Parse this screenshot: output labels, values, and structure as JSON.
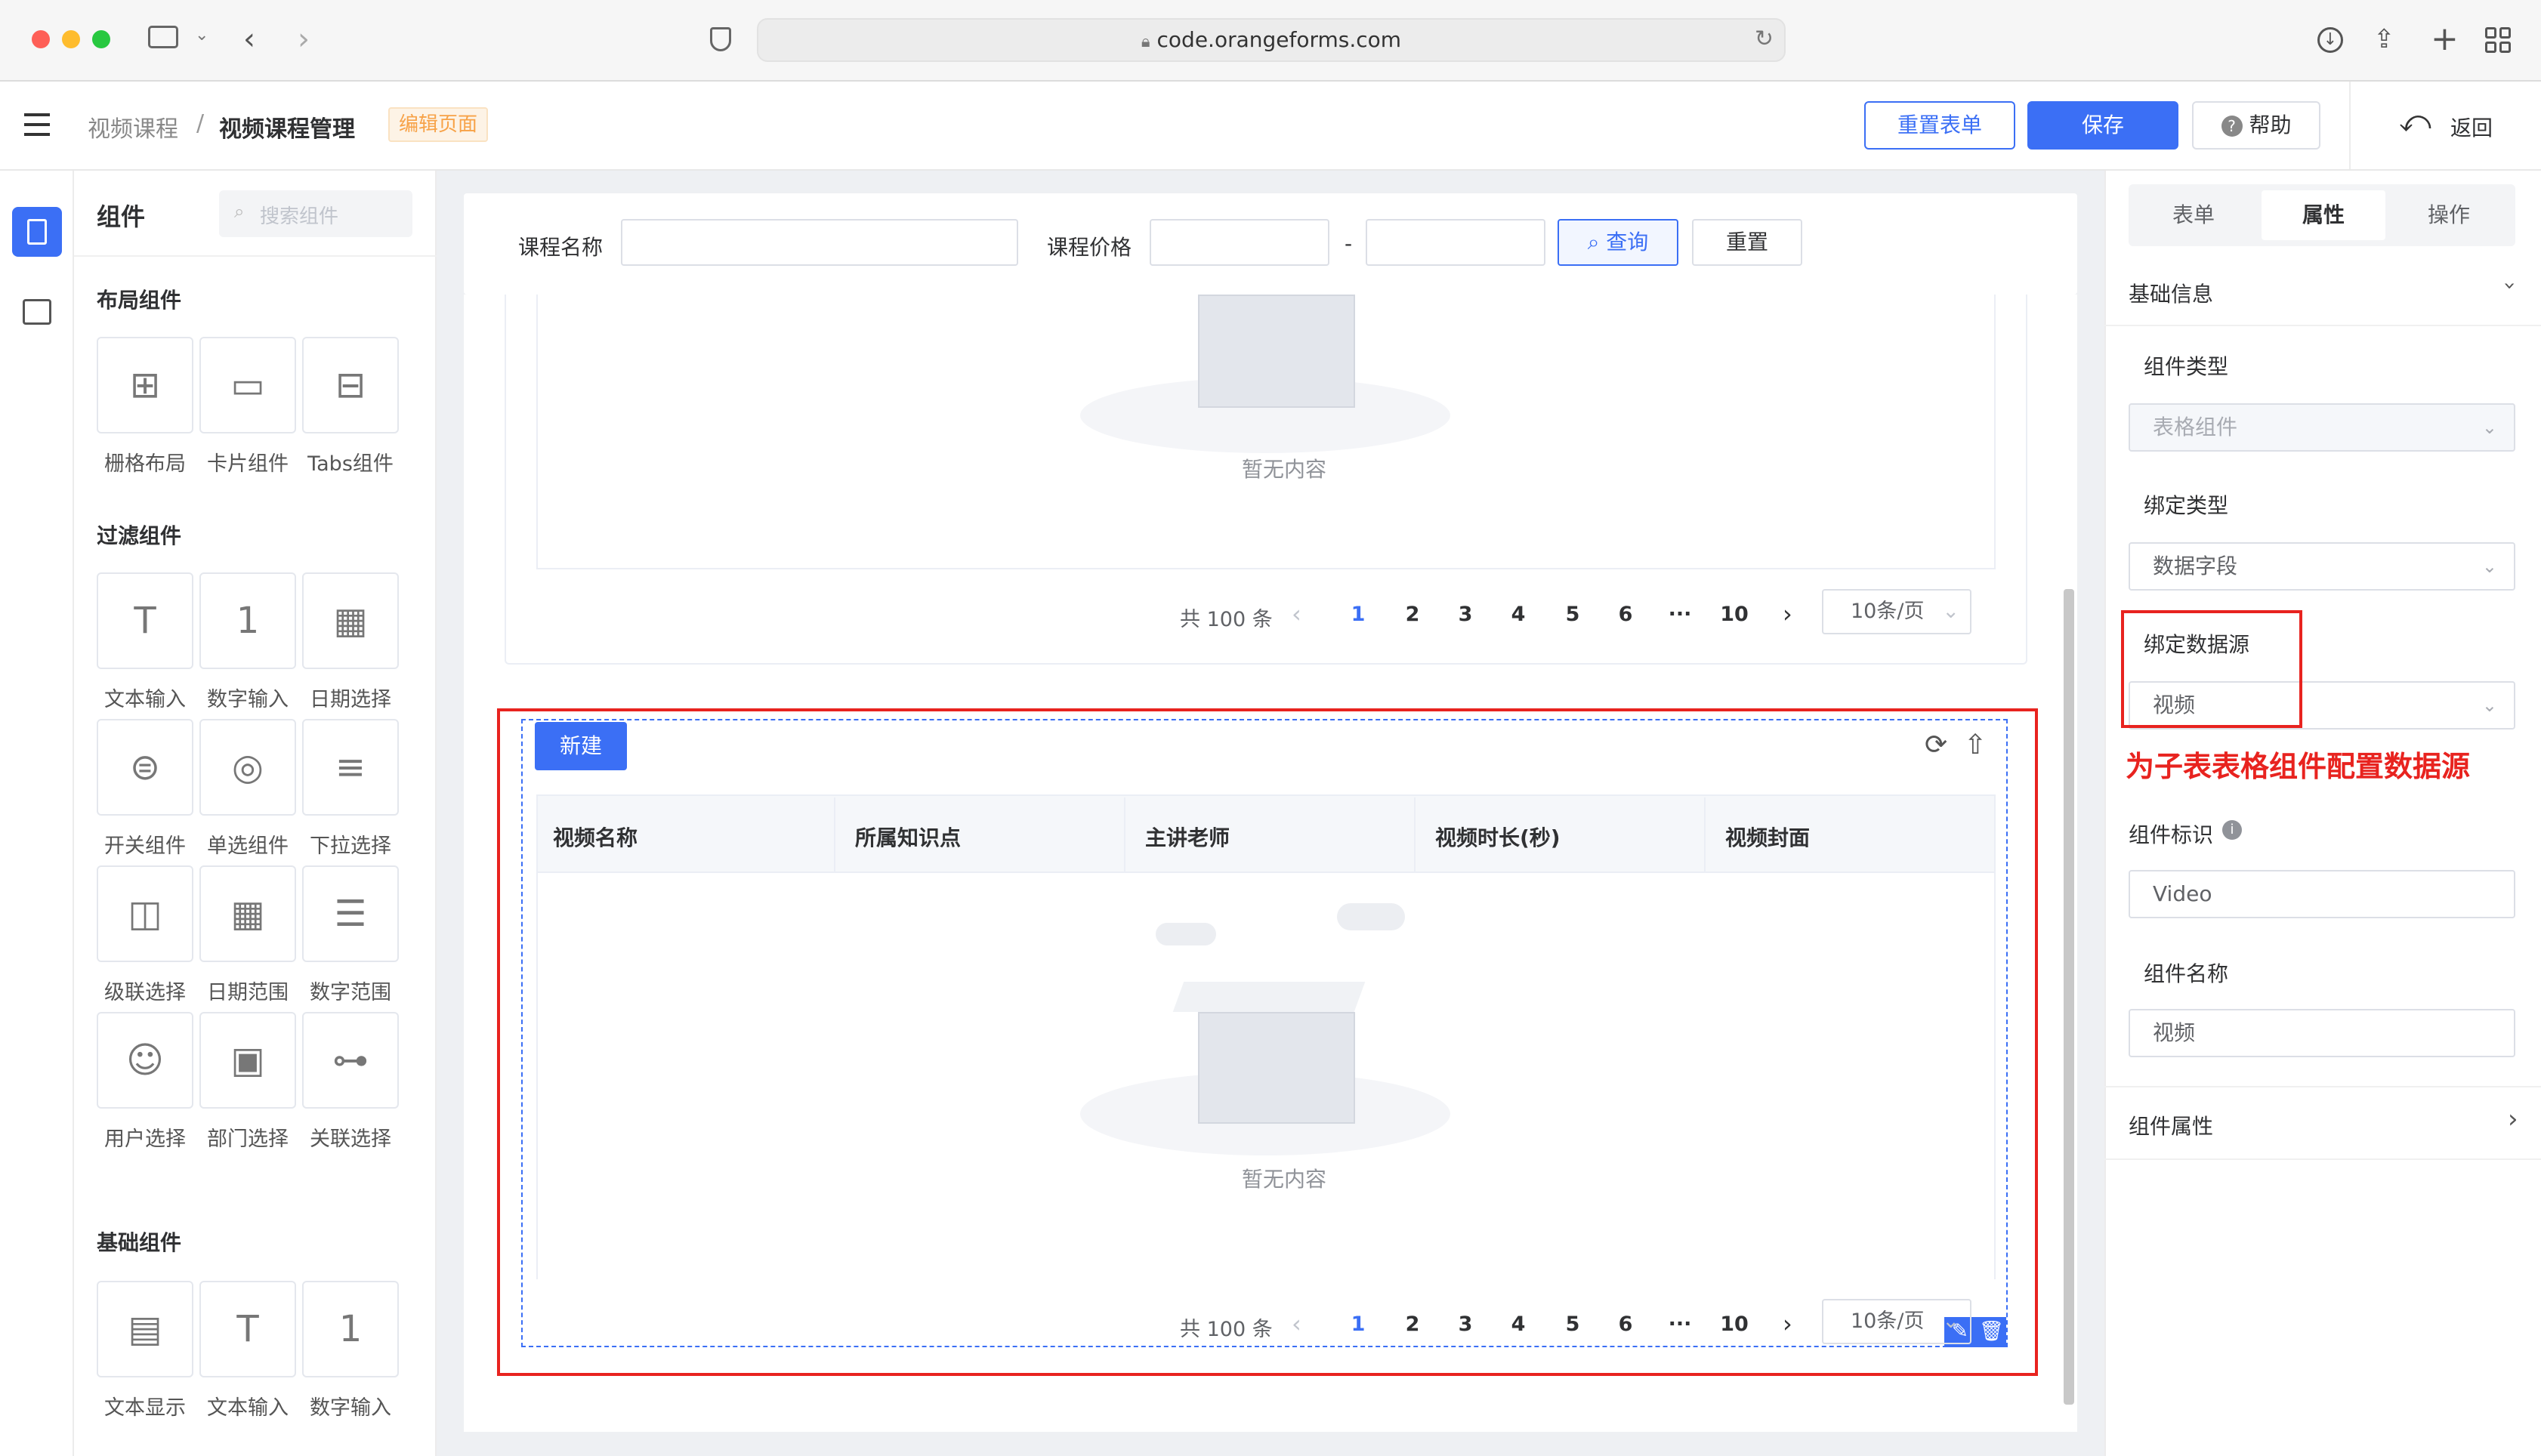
{
  "browser": {
    "url": "code.orangeforms.com"
  },
  "header": {
    "breadcrumb_parent": "视频课程",
    "breadcrumb_sep": "/",
    "breadcrumb_current": "视频课程管理",
    "mode_tag": "编辑页面",
    "reset_form": "重置表单",
    "save": "保存",
    "help": "帮助",
    "back": "返回"
  },
  "components": {
    "title": "组件",
    "search_placeholder": "搜索组件",
    "layout_title": "布局组件",
    "layout_items": [
      {
        "label": "栅格布局",
        "icon": "grid-icon"
      },
      {
        "label": "卡片组件",
        "icon": "card-icon"
      },
      {
        "label": "Tabs组件",
        "icon": "tabs-icon"
      }
    ],
    "filter_title": "过滤组件",
    "filter_items": [
      {
        "label": "文本输入",
        "icon": "text-input-icon"
      },
      {
        "label": "数字输入",
        "icon": "number-input-icon"
      },
      {
        "label": "日期选择",
        "icon": "calendar-icon"
      },
      {
        "label": "开关组件",
        "icon": "switch-icon"
      },
      {
        "label": "单选组件",
        "icon": "radio-icon"
      },
      {
        "label": "下拉选择",
        "icon": "dropdown-icon"
      },
      {
        "label": "级联选择",
        "icon": "cascader-icon"
      },
      {
        "label": "日期范围",
        "icon": "date-range-icon"
      },
      {
        "label": "数字范围",
        "icon": "number-range-icon"
      },
      {
        "label": "用户选择",
        "icon": "user-icon"
      },
      {
        "label": "部门选择",
        "icon": "department-icon"
      },
      {
        "label": "关联选择",
        "icon": "relation-icon"
      }
    ],
    "basic_title": "基础组件",
    "basic_items": [
      {
        "label": "文本显示",
        "icon": "text-display-icon"
      },
      {
        "label": "文本输入",
        "icon": "text-input-icon"
      },
      {
        "label": "数字输入",
        "icon": "number-input-icon"
      }
    ]
  },
  "filter": {
    "course_name_label": "课程名称",
    "course_price_label": "课程价格",
    "range_sep": "-",
    "query": "查询",
    "reset": "重置"
  },
  "top_table": {
    "empty": "暂无内容",
    "total": "共 100 条",
    "pages": [
      "1",
      "2",
      "3",
      "4",
      "5",
      "6",
      "···",
      "10"
    ],
    "page_size": "10条/页"
  },
  "sub_table": {
    "new_button": "新建",
    "columns": [
      "视频名称",
      "所属知识点",
      "主讲老师",
      "视频时长(秒)",
      "视频封面"
    ],
    "empty": "暂无内容",
    "total": "共 100 条",
    "pages": [
      "1",
      "2",
      "3",
      "4",
      "5",
      "6",
      "···",
      "10"
    ],
    "page_size": "10条/页"
  },
  "right": {
    "tabs": [
      "表单",
      "属性",
      "操作"
    ],
    "active_tab": "属性",
    "basic_info": "基础信息",
    "component_type_label": "组件类型",
    "component_type_value": "表格组件",
    "bind_type_label": "绑定类型",
    "bind_type_value": "数据字段",
    "datasource_label": "绑定数据源",
    "datasource_value": "视频",
    "annotation": "为子表表格组件配置数据源",
    "component_id_label": "组件标识",
    "component_id_value": "Video",
    "component_name_label": "组件名称",
    "component_name_value": "视频",
    "component_props": "组件属性"
  },
  "colors": {
    "primary": "#3b6ff5",
    "annotation_red": "#e8231f",
    "tag_orange": "#f7a247"
  }
}
